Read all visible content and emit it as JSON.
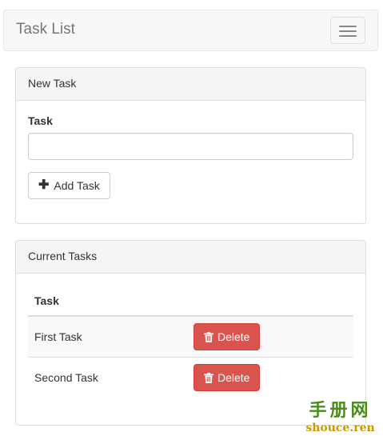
{
  "navbar": {
    "brand": "Task List",
    "toggle_icon": "hamburger-menu-icon"
  },
  "new_task_panel": {
    "heading": "New Task",
    "field_label": "Task",
    "input_value": "",
    "add_button_label": "Add Task",
    "add_button_icon": "plus-icon"
  },
  "current_tasks_panel": {
    "heading": "Current Tasks",
    "column_header": "Task",
    "tasks": [
      {
        "name": "First Task",
        "delete_label": "Delete"
      },
      {
        "name": "Second Task",
        "delete_label": "Delete"
      }
    ],
    "delete_icon": "trash-icon"
  },
  "watermark": {
    "top": "手册网",
    "bottom": "shouce.ren"
  },
  "colors": {
    "danger": "#d9534f",
    "panel_heading_bg": "#f5f5f5",
    "navbar_bg": "#f8f8f8"
  }
}
